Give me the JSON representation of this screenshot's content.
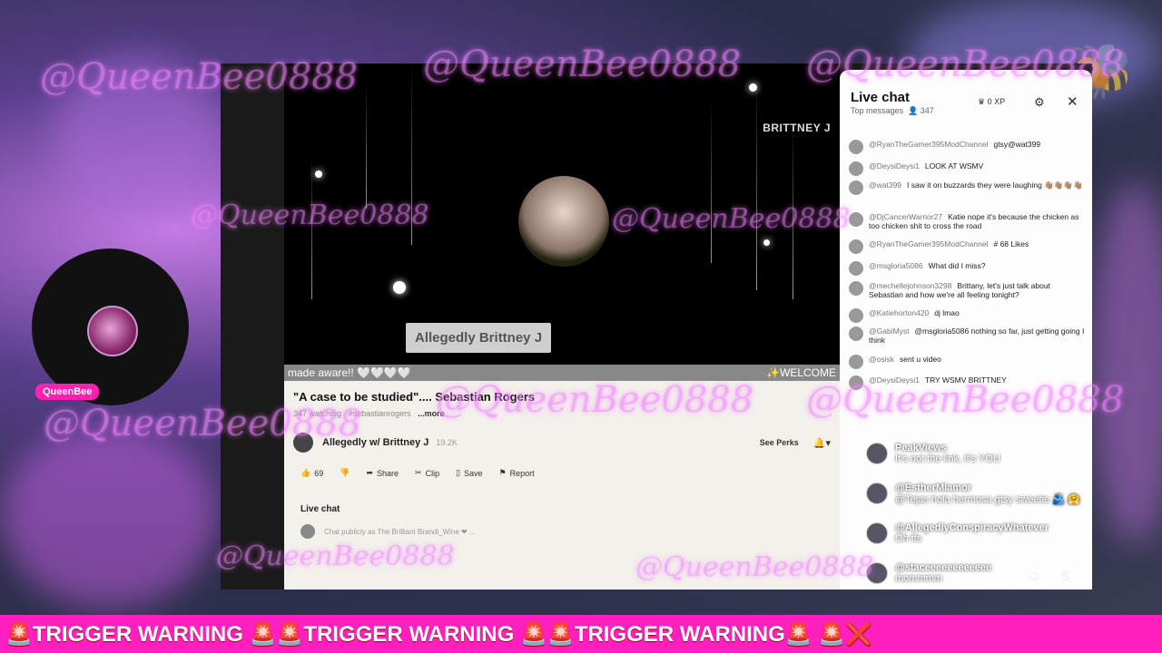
{
  "watermark": "@QueenBee0888",
  "left_badge": {
    "name": "QueenBee"
  },
  "video": {
    "caption": "Allegedly Brittney J",
    "brand": "BRITTNEY J",
    "ticker_left": "made aware!! 🤍🤍🤍🤍",
    "ticker_right": "✨WELCOME"
  },
  "stream": {
    "title": "\"A case to be studied\"....  Sebastian Rogers",
    "watching": "347 watching",
    "hashtag": "#sebastianrogers",
    "more": "...more",
    "channel_name": "Allegedly w/ Brittney J",
    "channel_subs": "19.2K",
    "see_perks": "See Perks",
    "likes": "69",
    "share": "Share",
    "clip": "Clip",
    "save": "Save",
    "report": "Report",
    "live_chat_label": "Live chat",
    "chat_placeholder": "Chat publicly as The Brilliant Brandi_Wine ❤ ..."
  },
  "chat": {
    "title": "Live chat",
    "subtitle": "Top messages",
    "viewers": "347",
    "xp": "0 XP",
    "messages": [
      {
        "user": "@RyanTheGamer395ModChannel",
        "text": "gtsy@wat399"
      },
      {
        "user": "@DeysiDeysi1",
        "text": "LOOK AT WSMV"
      },
      {
        "user": "@wat399",
        "text": "I saw it on buzzards they were laughing 👋🏽👋🏽👋🏽👋🏽"
      },
      {
        "user": "@DjCancerWarrior27",
        "text": "Katie nope it's because the chicken as too chicken shit to cross the road"
      },
      {
        "user": "@RyanTheGamer395ModChannel",
        "text": "# 68 Likes"
      },
      {
        "user": "@msgloria5086",
        "text": "What did I miss?"
      },
      {
        "user": "@mechellejohnson3298",
        "text": "Brittany, let's just talk about Sebastian and how we're all feeling tonight?"
      },
      {
        "user": "@Katiehorton420",
        "text": "dj lmao"
      },
      {
        "user": "@GabiMyst",
        "text": "@msgloria5086 nothing so far, just getting going I think"
      },
      {
        "user": "@osisk",
        "text": "sent u video"
      },
      {
        "user": "@DeysiDeysi1",
        "text": "TRY WSMV BRITTNEY"
      }
    ]
  },
  "overlay": [
    {
      "name": "PeakViews",
      "text": "It's not the link, it's YOU"
    },
    {
      "name": "@EstherMiamor",
      "text": "@Tejas hola hermosa gtsy sweetie 🫂 🤗"
    },
    {
      "name": "@AllegedlyConspiracyWhatever",
      "text": "Oh ffs"
    },
    {
      "name": "@staceeeeeeeeeeee",
      "text": "mommmm"
    }
  ],
  "trigger": "🚨TRIGGER WARNING 🚨🚨TRIGGER WARNING 🚨🚨TRIGGER WARNING🚨 🚨❌"
}
